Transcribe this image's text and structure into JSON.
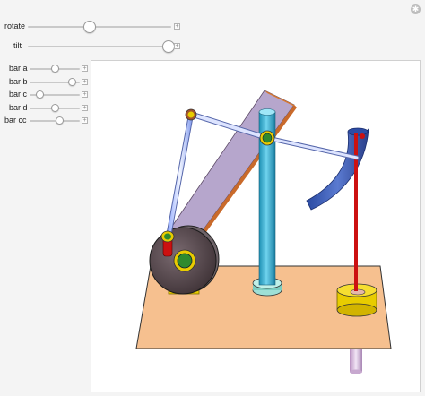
{
  "controls": {
    "rotate": {
      "label": "rotate",
      "value": 0.43
    },
    "tilt": {
      "label": "tilt",
      "value": 0.98
    },
    "bar_a": {
      "label": "bar a",
      "value": 0.5
    },
    "bar_b": {
      "label": "bar b",
      "value": 0.85
    },
    "bar_c": {
      "label": "bar c",
      "value": 0.2
    },
    "bar_d": {
      "label": "bar d",
      "value": 0.5
    },
    "bar_cc": {
      "label": "bar cc",
      "value": 0.6
    }
  },
  "icons": {
    "settings": "gear-icon",
    "expand": "plus-icon"
  },
  "colors": {
    "base_plate": "#f6c08f",
    "wheel": "#5a4a50",
    "arm_plate": "#b6a6cc",
    "column": "#3fb3d6",
    "rod": "#cc1111",
    "joint_yellow": "#f2d300",
    "joint_green": "#2e8a2e",
    "curved_link": "#3a5ab0"
  }
}
